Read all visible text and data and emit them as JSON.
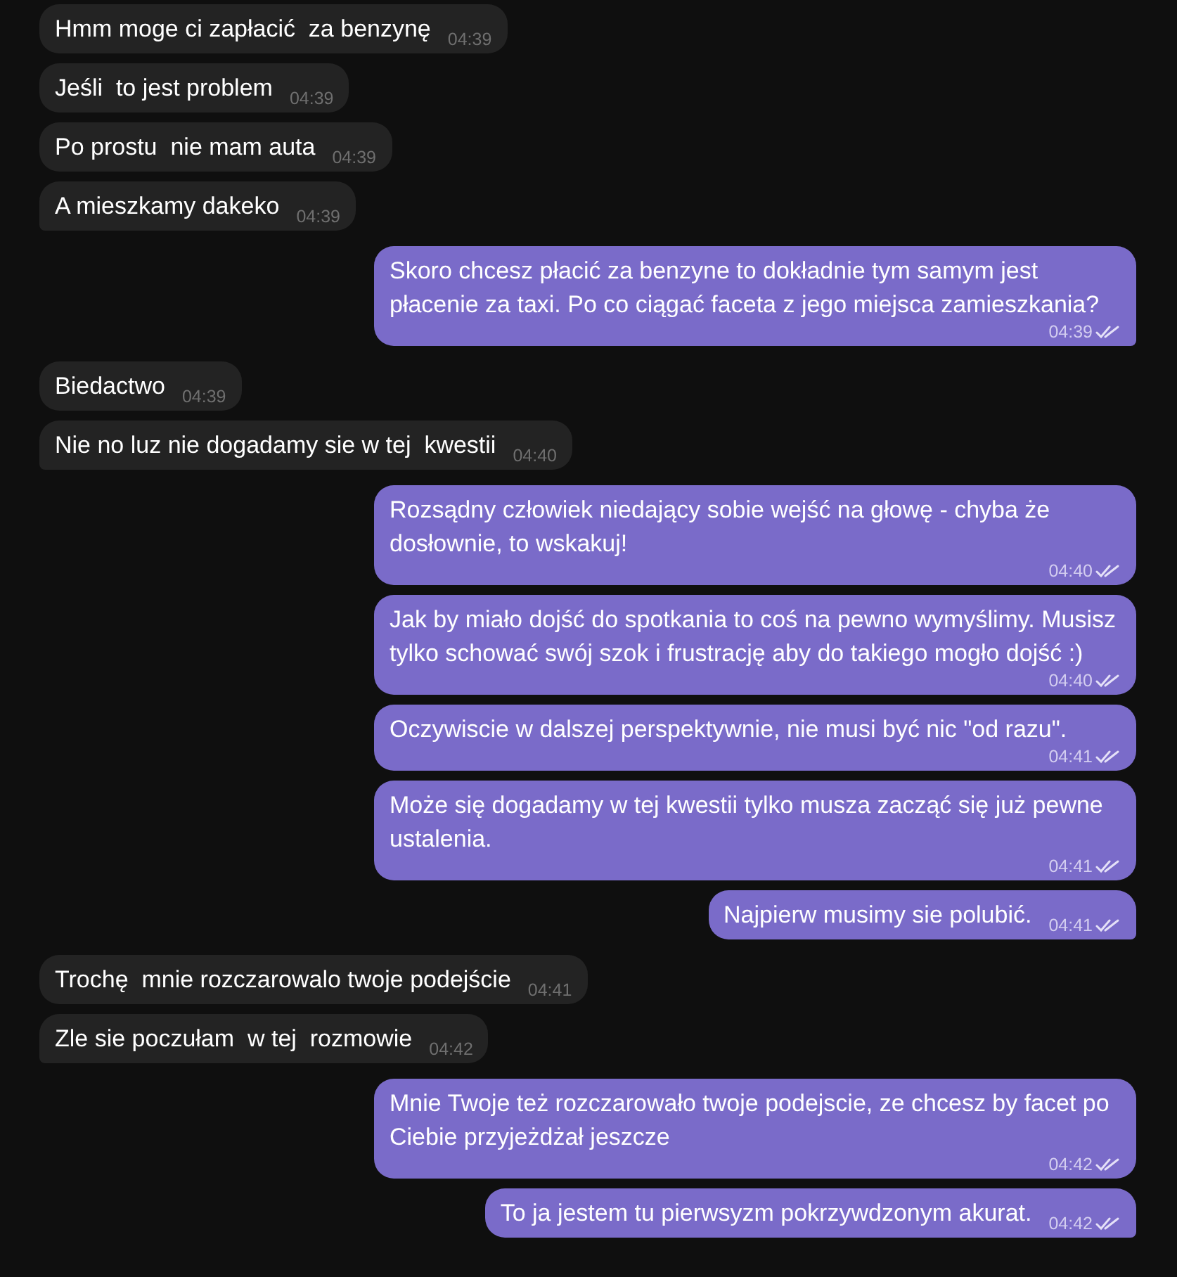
{
  "messages": [
    {
      "kind": "incoming",
      "text": "Hmm moge ci zapłacić  za benzynę",
      "time": "04:39"
    },
    {
      "kind": "incoming",
      "text": "Jeśli  to jest problem",
      "time": "04:39"
    },
    {
      "kind": "incoming",
      "text": "Po prostu  nie mam auta",
      "time": "04:39"
    },
    {
      "kind": "incoming",
      "text": "A mieszkamy dakeko",
      "time": "04:39"
    },
    {
      "kind": "outgoing",
      "text": "Skoro chcesz płacić za benzyne to dokładnie tym samym jest płacenie za taxi. Po co ciągać faceta z jego miejsca zamieszkania?",
      "time": "04:39",
      "read": true
    },
    {
      "kind": "incoming",
      "text": "Biedactwo",
      "time": "04:39"
    },
    {
      "kind": "incoming",
      "text": "Nie no luz nie dogadamy sie w tej  kwestii",
      "time": "04:40"
    },
    {
      "kind": "outgoing",
      "text": "Rozsądny człowiek niedający sobie wejść na głowę - chyba że dosłownie, to wskakuj!",
      "time": "04:40",
      "read": true
    },
    {
      "kind": "outgoing",
      "text": "Jak by miało dojść do spotkania to coś na pewno wymyślimy. Musisz tylko schować swój szok i frustrację aby do takiego mogło dojść :)",
      "time": "04:40",
      "read": true
    },
    {
      "kind": "outgoing",
      "text": "Oczywiscie w dalszej perspektywnie, nie musi być nic \"od razu\".",
      "time": "04:41",
      "read": true
    },
    {
      "kind": "outgoing",
      "text": "Może się dogadamy w tej kwestii tylko musza zacząć się już pewne ustalenia.",
      "time": "04:41",
      "read": true
    },
    {
      "kind": "outgoing",
      "text": "Najpierw musimy sie polubić.",
      "time": "04:41",
      "read": true
    },
    {
      "kind": "incoming",
      "text": "Trochę  mnie rozczarowalo twoje podejście",
      "time": "04:41"
    },
    {
      "kind": "incoming",
      "text": "Zle sie poczułam  w tej  rozmowie",
      "time": "04:42"
    },
    {
      "kind": "outgoing",
      "text": "Mnie Twoje też rozczarowało twoje podejscie, ze chcesz by facet po Ciebie przyjeżdżał jeszcze",
      "time": "04:42",
      "read": true
    },
    {
      "kind": "outgoing",
      "text": "To ja jestem tu pierwsyzm pokrzywdzonym akurat.",
      "time": "04:42",
      "read": true
    }
  ]
}
